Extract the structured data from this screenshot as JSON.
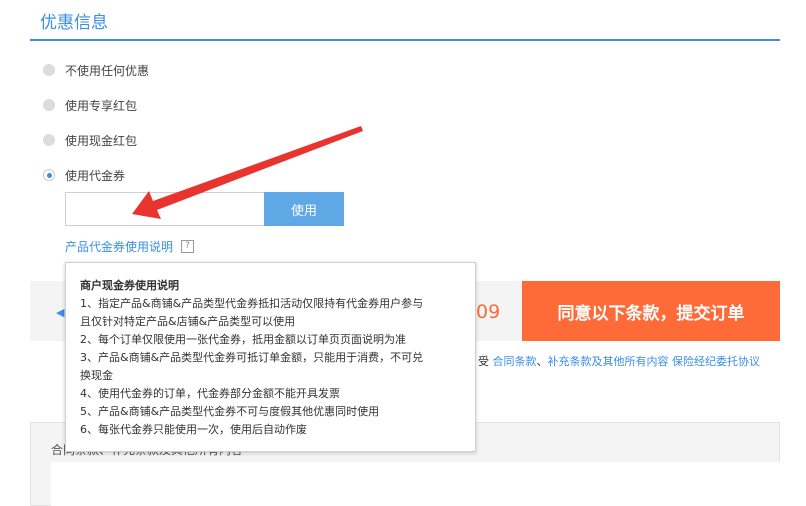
{
  "section_title": "优惠信息",
  "options": [
    {
      "label": "不使用任何优惠",
      "checked": false
    },
    {
      "label": "使用专享红包",
      "checked": false
    },
    {
      "label": "使用现金红包",
      "checked": false
    },
    {
      "label": "使用代金券",
      "checked": true
    }
  ],
  "voucher": {
    "input_value": "",
    "use_button": "使用"
  },
  "help_link": {
    "label": "产品代金券使用说明",
    "icon": "?"
  },
  "tooltip": {
    "title": "商户现金券使用说明",
    "lines": [
      "1、指定产品&商铺&产品类型代金券抵扣活动仅限持有代金券用户参与",
      "且仅针对特定产品&店铺&产品类型可以使用",
      "2、每个订单仅限使用一张代金券，抵用金额以订单页页面说明为准",
      "3、产品&商铺&产品类型代金券可抵订单金额，只能用于消费，不可兑",
      "换现金",
      "4、使用代金券的订单，代金券部分金额不能开具发票",
      "5、产品&商铺&产品类型代金券不可与度假其他优惠同时使用",
      "6、每张代金券只能使用一次，使用后自动作废"
    ]
  },
  "submit": {
    "label": "同意以下条款，提交订单",
    "price_fragment": "09",
    "arrow": "◀"
  },
  "agreement": {
    "prefix": "受",
    "link1": "合同条款",
    "sep": "、",
    "link2": "补充条款及其他所有内容",
    "link3": "保险经纪委托协议"
  },
  "contract_heading": "合同条款、补充条款及其他所有内容",
  "colors": {
    "accent": "#3a8ee6",
    "submit": "#ff6a39",
    "arrow": "#e8332e"
  }
}
